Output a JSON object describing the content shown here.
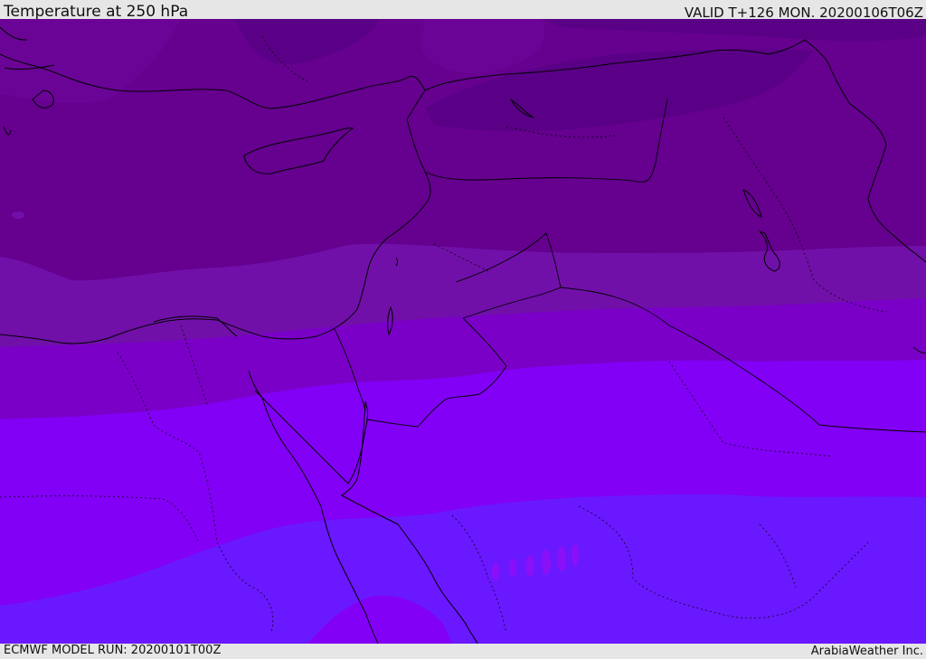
{
  "header": {
    "title": "Temperature at 250 hPa",
    "valid": "VALID T+126 MON. 20200106T06Z"
  },
  "footer": {
    "model_run": "ECMWF MODEL RUN: 20200101T00Z",
    "credit": "ArabiaWeather Inc."
  },
  "map": {
    "field": "temperature-250hPa",
    "palette": [
      "#5a0086",
      "#65008f",
      "#7010a8",
      "#7a00c8",
      "#8200f5",
      "#6a18ff"
    ],
    "coastline_color": "#000000",
    "border_style": "dotted"
  }
}
